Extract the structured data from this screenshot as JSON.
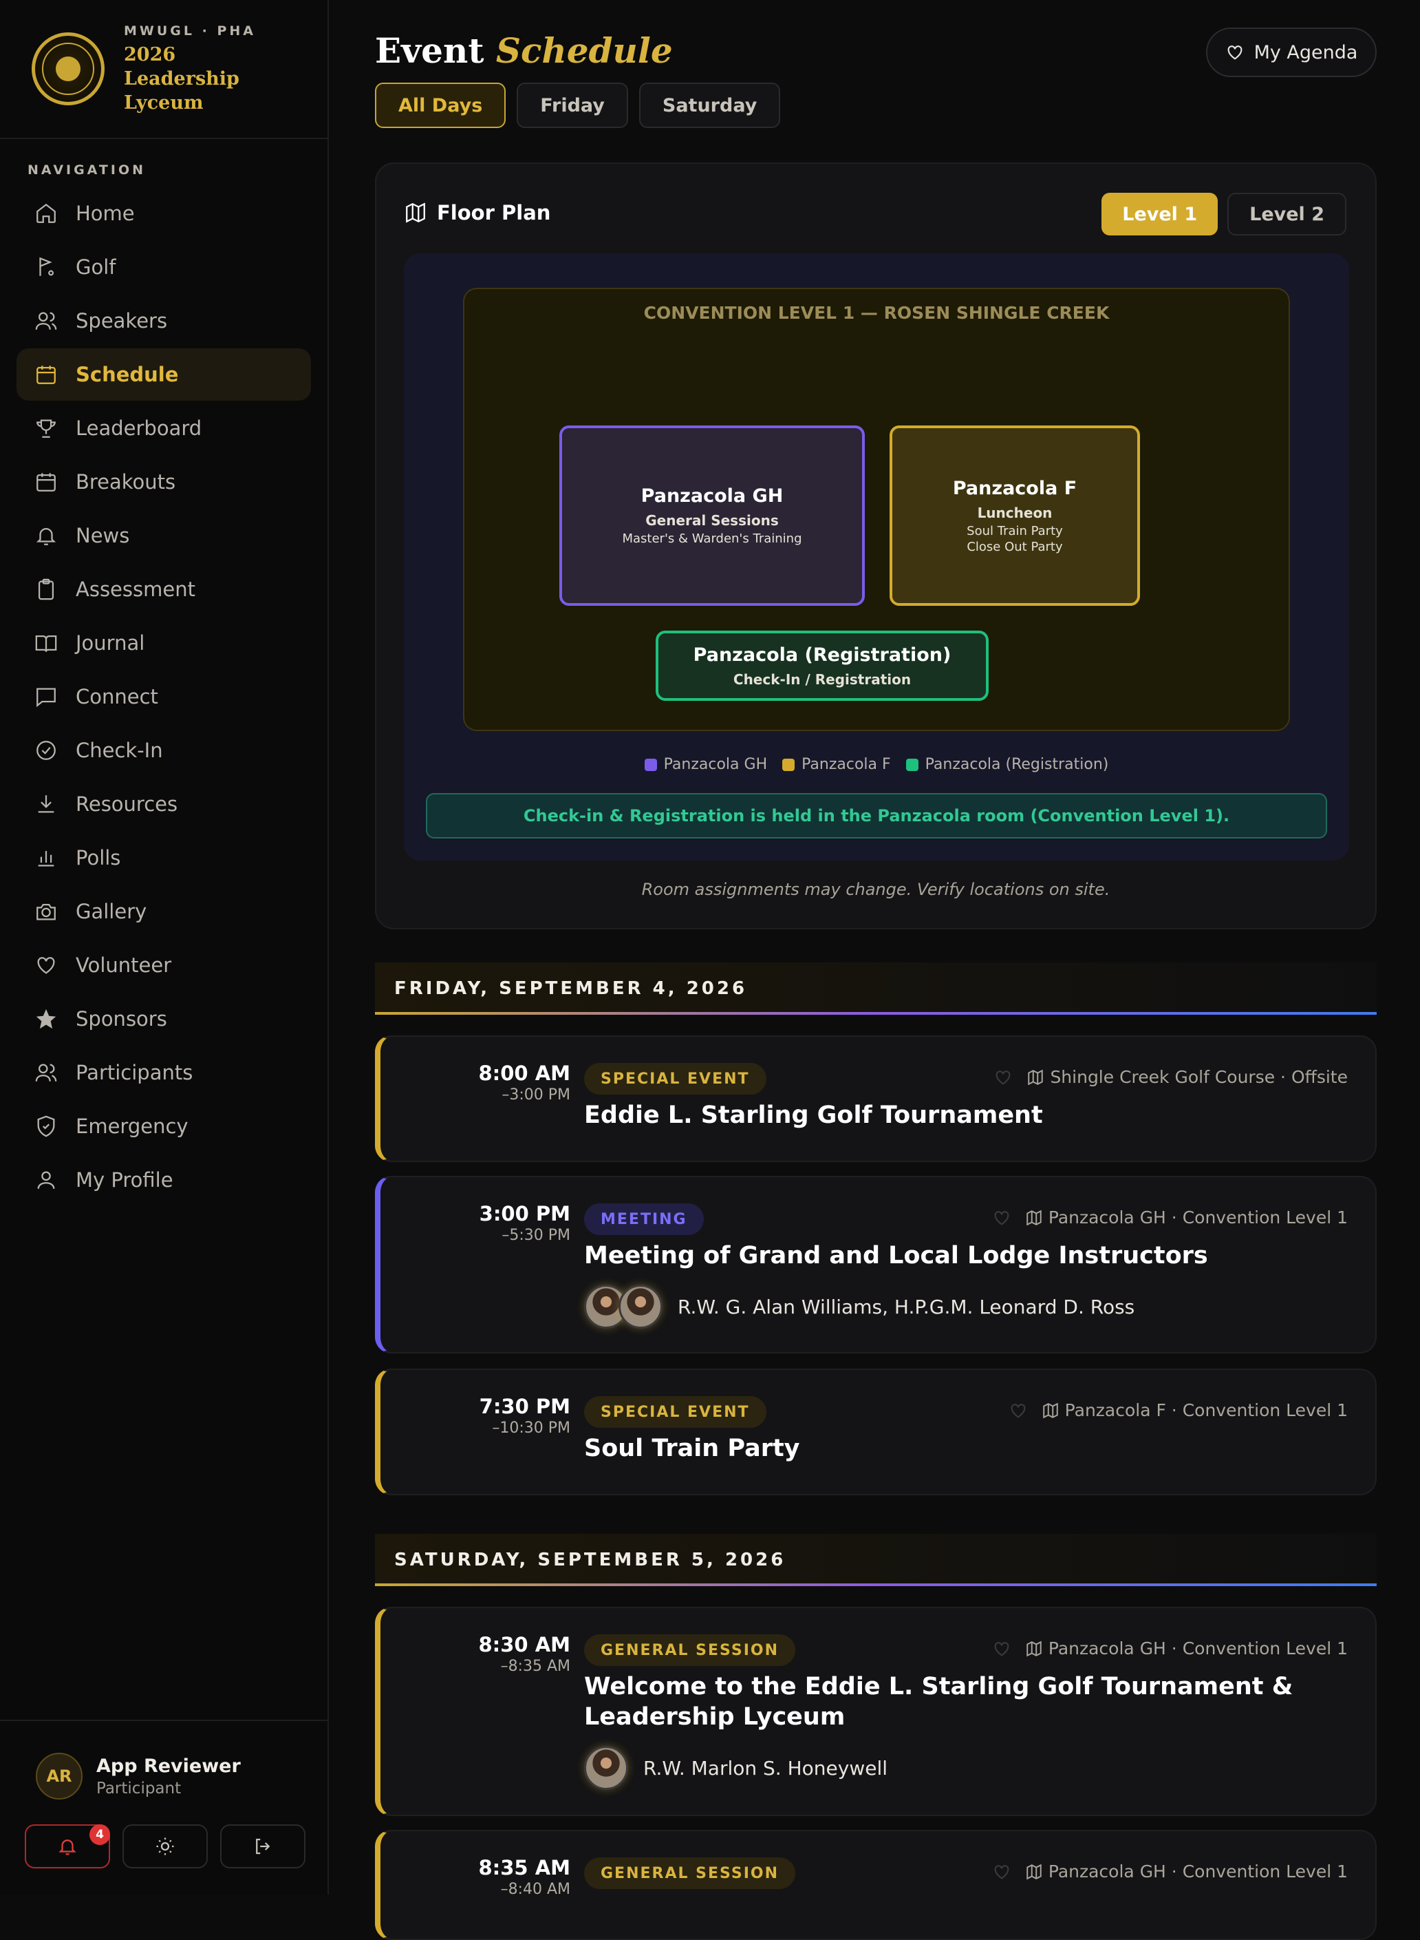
{
  "sidebar": {
    "kicker": "MWUGL · PHA",
    "title": "2026 Leadership Lyceum",
    "nav_label": "NAVIGATION",
    "items": [
      {
        "label": "Home",
        "icon": "home-icon"
      },
      {
        "label": "Golf",
        "icon": "golf-flag-icon"
      },
      {
        "label": "Speakers",
        "icon": "users-icon"
      },
      {
        "label": "Schedule",
        "icon": "calendar-icon",
        "active": true
      },
      {
        "label": "Leaderboard",
        "icon": "trophy-icon"
      },
      {
        "label": "Breakouts",
        "icon": "calendar-icon"
      },
      {
        "label": "News",
        "icon": "bell-icon"
      },
      {
        "label": "Assessment",
        "icon": "clipboard-icon"
      },
      {
        "label": "Journal",
        "icon": "book-icon"
      },
      {
        "label": "Connect",
        "icon": "message-icon"
      },
      {
        "label": "Check-In",
        "icon": "check-circle-icon"
      },
      {
        "label": "Resources",
        "icon": "download-icon"
      },
      {
        "label": "Polls",
        "icon": "bar-chart-icon"
      },
      {
        "label": "Gallery",
        "icon": "camera-icon"
      },
      {
        "label": "Volunteer",
        "icon": "heart-icon"
      },
      {
        "label": "Sponsors",
        "icon": "star-icon"
      },
      {
        "label": "Participants",
        "icon": "users-icon"
      },
      {
        "label": "Emergency",
        "icon": "shield-icon"
      },
      {
        "label": "My Profile",
        "icon": "user-icon"
      }
    ],
    "user": {
      "initials": "AR",
      "name": "App Reviewer",
      "role": "Participant"
    },
    "notifications_count": "4"
  },
  "header": {
    "title_plain": "Event",
    "title_accent": "Schedule",
    "agenda_button": "My Agenda",
    "tabs": [
      "All Days",
      "Friday",
      "Saturday"
    ],
    "active_tab": "All Days"
  },
  "floor_plan": {
    "title": "Floor Plan",
    "levels": [
      "Level 1",
      "Level 2"
    ],
    "active_level": "Level 1",
    "hall_title": "CONVENTION LEVEL 1 — ROSEN SHINGLE CREEK",
    "rooms": [
      {
        "name": "Panzacola GH",
        "sub": "General Sessions",
        "lines": [
          "Master's & Warden's Training"
        ],
        "color": "#7b5ce8"
      },
      {
        "name": "Panzacola F",
        "sub": "Luncheon",
        "lines": [
          "Soul Train Party",
          "Close Out Party"
        ],
        "color": "#d4ab2d"
      },
      {
        "name": "Panzacola (Registration)",
        "sub": "Check-In / Registration",
        "lines": [],
        "color": "#1ec07e"
      }
    ],
    "legend": [
      "Panzacola GH",
      "Panzacola F",
      "Panzacola (Registration)"
    ],
    "notice": "Check-in & Registration is held in the Panzacola room (Convention Level 1).",
    "note": "Room assignments may change. Verify locations on site."
  },
  "days": [
    {
      "label": "FRIDAY, SEPTEMBER 4, 2026",
      "events": [
        {
          "start": "8:00 AM",
          "end": "–3:00 PM",
          "tag": "SPECIAL EVENT",
          "location": "Shingle Creek Golf Course · Offsite",
          "name": "Eddie L. Starling Golf Tournament",
          "speakers": ""
        },
        {
          "start": "3:00 PM",
          "end": "–5:30 PM",
          "tag": "MEETING",
          "location": "Panzacola GH · Convention Level 1",
          "name": "Meeting of Grand and Local Lodge Instructors",
          "speakers": "R.W. G. Alan Williams, H.P.G.M. Leonard D. Ross"
        },
        {
          "start": "7:30 PM",
          "end": "–10:30 PM",
          "tag": "SPECIAL EVENT",
          "location": "Panzacola F · Convention Level 1",
          "name": "Soul Train Party",
          "speakers": ""
        }
      ]
    },
    {
      "label": "SATURDAY, SEPTEMBER 5, 2026",
      "events": [
        {
          "start": "8:30 AM",
          "end": "–8:35 AM",
          "tag": "GENERAL SESSION",
          "location": "Panzacola GH · Convention Level 1",
          "name": "Welcome to the Eddie L. Starling Golf Tournament & Leadership Lyceum",
          "speakers": "R.W. Marlon S. Honeywell"
        },
        {
          "start": "8:35 AM",
          "end": "–8:40 AM",
          "tag": "GENERAL SESSION",
          "location": "Panzacola GH · Convention Level 1",
          "name": "",
          "speakers": ""
        }
      ]
    }
  ],
  "colors": {
    "accent": "#d4ab2d",
    "purple": "#7b5ce8",
    "green": "#1ec07e",
    "background": "#0c0c0d"
  }
}
